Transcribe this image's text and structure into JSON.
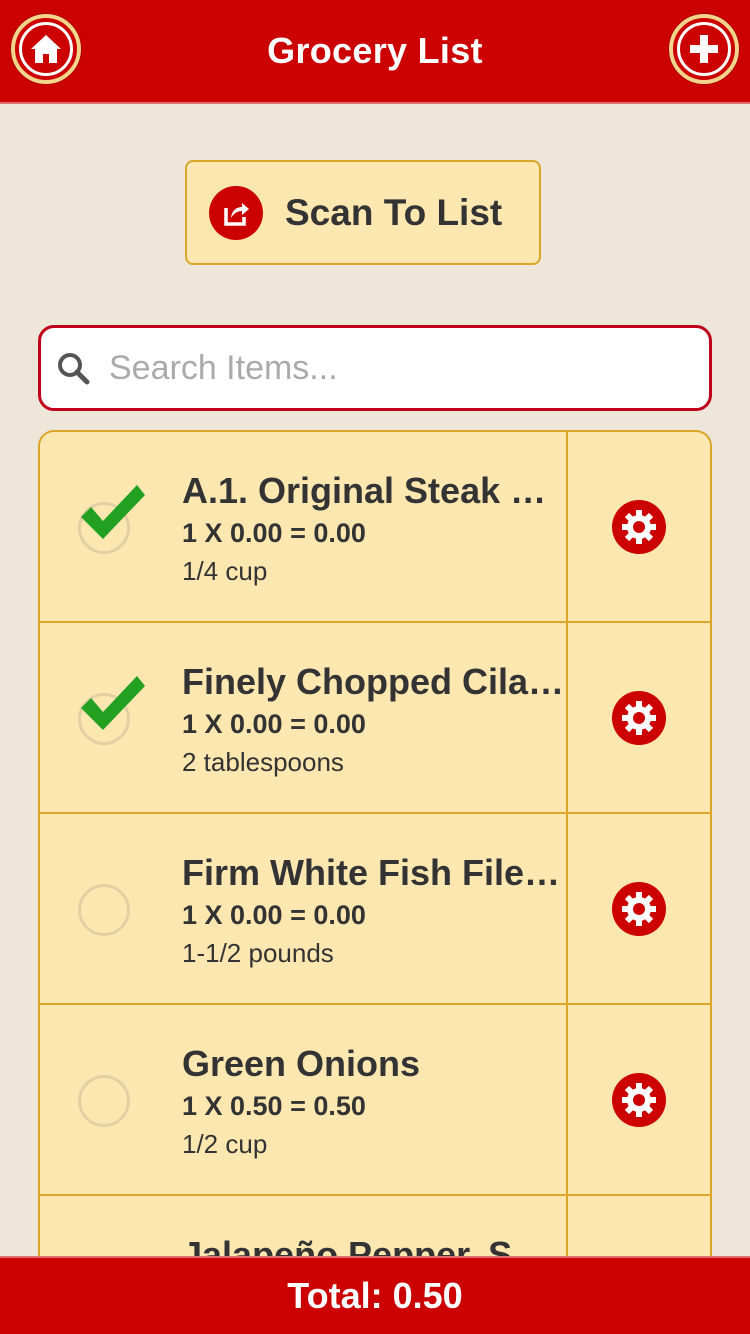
{
  "header": {
    "title": "Grocery List",
    "home_icon": "home-icon",
    "add_icon": "plus-icon"
  },
  "scan": {
    "label": "Scan To List",
    "icon": "share-icon"
  },
  "search": {
    "placeholder": "Search Items...",
    "value": ""
  },
  "items": [
    {
      "name": "A.1. Original Steak …",
      "calc": "1 X 0.00 = 0.00",
      "qty": "1/4 cup",
      "checked": true
    },
    {
      "name": "Finely Chopped Cila…",
      "calc": "1 X 0.00 = 0.00",
      "qty": "2 tablespoons",
      "checked": true
    },
    {
      "name": "Firm White Fish File…",
      "calc": "1 X 0.00 = 0.00",
      "qty": "1-1/2 pounds",
      "checked": false
    },
    {
      "name": "Green Onions",
      "calc": "1 X 0.50 = 0.50",
      "qty": "1/2 cup",
      "checked": false
    },
    {
      "name": "Jalapeño Pepper, S…",
      "calc": "",
      "qty": "",
      "checked": false
    }
  ],
  "footer": {
    "total": "Total: 0.50"
  },
  "colors": {
    "accent": "#cc0000",
    "panel": "#fde7b0",
    "border": "#d9a62a",
    "background": "#efe6da",
    "check": "#22a022"
  }
}
